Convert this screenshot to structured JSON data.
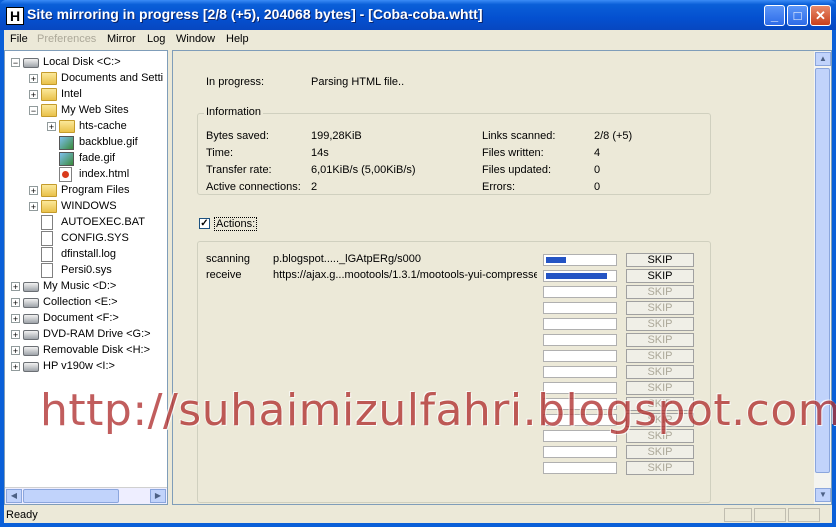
{
  "window": {
    "title": "Site mirroring in progress [2/8 (+5), 204068 bytes] - [Coba-coba.whtt]",
    "app_icon": "H",
    "controls": {
      "minimize": "_",
      "maximize": "□",
      "close": "✕"
    }
  },
  "menu": {
    "items": [
      "File",
      "Preferences",
      "Mirror",
      "Log",
      "Window",
      "Help"
    ],
    "disabled": [
      "Preferences"
    ]
  },
  "tree": {
    "nodes": [
      {
        "label": "Local Disk <C:>",
        "icon": "drive-icon",
        "expander": "−"
      },
      {
        "label": "Documents and Setti",
        "icon": "folder-icon",
        "expander": "+"
      },
      {
        "label": "Intel",
        "icon": "folder-icon",
        "expander": "+"
      },
      {
        "label": "My Web Sites",
        "icon": "folder-icon",
        "expander": "−"
      },
      {
        "label": "hts-cache",
        "icon": "folder-icon",
        "expander": "+"
      },
      {
        "label": "backblue.gif",
        "icon": "image-file-icon",
        "expander": ""
      },
      {
        "label": "fade.gif",
        "icon": "image-file-icon",
        "expander": ""
      },
      {
        "label": "index.html",
        "icon": "html-file-icon",
        "expander": ""
      },
      {
        "label": "Program Files",
        "icon": "folder-icon",
        "expander": "+"
      },
      {
        "label": "WINDOWS",
        "icon": "folder-icon",
        "expander": "+"
      },
      {
        "label": "AUTOEXEC.BAT",
        "icon": "file-icon",
        "expander": ""
      },
      {
        "label": "CONFIG.SYS",
        "icon": "file-icon",
        "expander": ""
      },
      {
        "label": "dfinstall.log",
        "icon": "file-icon",
        "expander": ""
      },
      {
        "label": "Persi0.sys",
        "icon": "file-icon",
        "expander": ""
      },
      {
        "label": "My Music <D:>",
        "icon": "drive-icon",
        "expander": "+"
      },
      {
        "label": "Collection <E:>",
        "icon": "drive-icon",
        "expander": "+"
      },
      {
        "label": "Document <F:>",
        "icon": "drive-icon",
        "expander": "+"
      },
      {
        "label": "DVD-RAM Drive <G:>",
        "icon": "dvd-drive-icon",
        "expander": "+"
      },
      {
        "label": "Removable Disk <H:>",
        "icon": "removable-drive-icon",
        "expander": "+"
      },
      {
        "label": "HP v190w <I:>",
        "icon": "removable-drive-icon",
        "expander": "+"
      }
    ]
  },
  "progress": {
    "in_progress_label": "In progress:",
    "in_progress_value": "Parsing HTML file.."
  },
  "information": {
    "legend": "Information",
    "left": [
      {
        "label": "Bytes saved:",
        "value": "199,28KiB"
      },
      {
        "label": "Time:",
        "value": "14s"
      },
      {
        "label": "Transfer rate:",
        "value": "6,01KiB/s (5,00KiB/s)"
      },
      {
        "label": "Active connections:",
        "value": "2"
      }
    ],
    "right": [
      {
        "label": "Links scanned:",
        "value": "2/8 (+5)"
      },
      {
        "label": "Files written:",
        "value": "4"
      },
      {
        "label": "Files updated:",
        "value": "0"
      },
      {
        "label": "Errors:",
        "value": "0"
      }
    ]
  },
  "actions": {
    "label": "Actions:",
    "checked": true,
    "check_glyph": "✓",
    "rows": [
      {
        "status": "scanning",
        "url": "p.blogspot....._lGAtpERg/s000",
        "progress": 0.3,
        "skip": "SKIP",
        "enabled": true
      },
      {
        "status": "receive",
        "url": "https://ajax.g...mootools/1.3.1/mootools-yui-compressed",
        "progress": 0.9,
        "skip": "SKIP",
        "enabled": true
      },
      {
        "status": "",
        "url": "",
        "progress": 0,
        "skip": "SKIP",
        "enabled": false
      },
      {
        "status": "",
        "url": "",
        "progress": 0,
        "skip": "SKIP",
        "enabled": false
      },
      {
        "status": "",
        "url": "",
        "progress": 0,
        "skip": "SKIP",
        "enabled": false
      },
      {
        "status": "",
        "url": "",
        "progress": 0,
        "skip": "SKIP",
        "enabled": false
      },
      {
        "status": "",
        "url": "",
        "progress": 0,
        "skip": "SKIP",
        "enabled": false
      },
      {
        "status": "",
        "url": "",
        "progress": 0,
        "skip": "SKIP",
        "enabled": false
      },
      {
        "status": "",
        "url": "",
        "progress": 0,
        "skip": "SKIP",
        "enabled": false
      },
      {
        "status": "",
        "url": "",
        "progress": 0,
        "skip": "SKIP",
        "enabled": false
      },
      {
        "status": "",
        "url": "",
        "progress": 0,
        "skip": "SKIP",
        "enabled": false
      },
      {
        "status": "",
        "url": "",
        "progress": 0,
        "skip": "SKIP",
        "enabled": false
      },
      {
        "status": "",
        "url": "",
        "progress": 0,
        "skip": "SKIP",
        "enabled": false
      },
      {
        "status": "",
        "url": "",
        "progress": 0,
        "skip": "SKIP",
        "enabled": false
      }
    ]
  },
  "watermark": "http://suhaimizulfahri.blogspot.com",
  "statusbar": {
    "text": "Ready"
  },
  "colors": {
    "titlebar": "#0a5fd8",
    "progress_fill": "#2454c4",
    "watermark": "#b03030"
  }
}
